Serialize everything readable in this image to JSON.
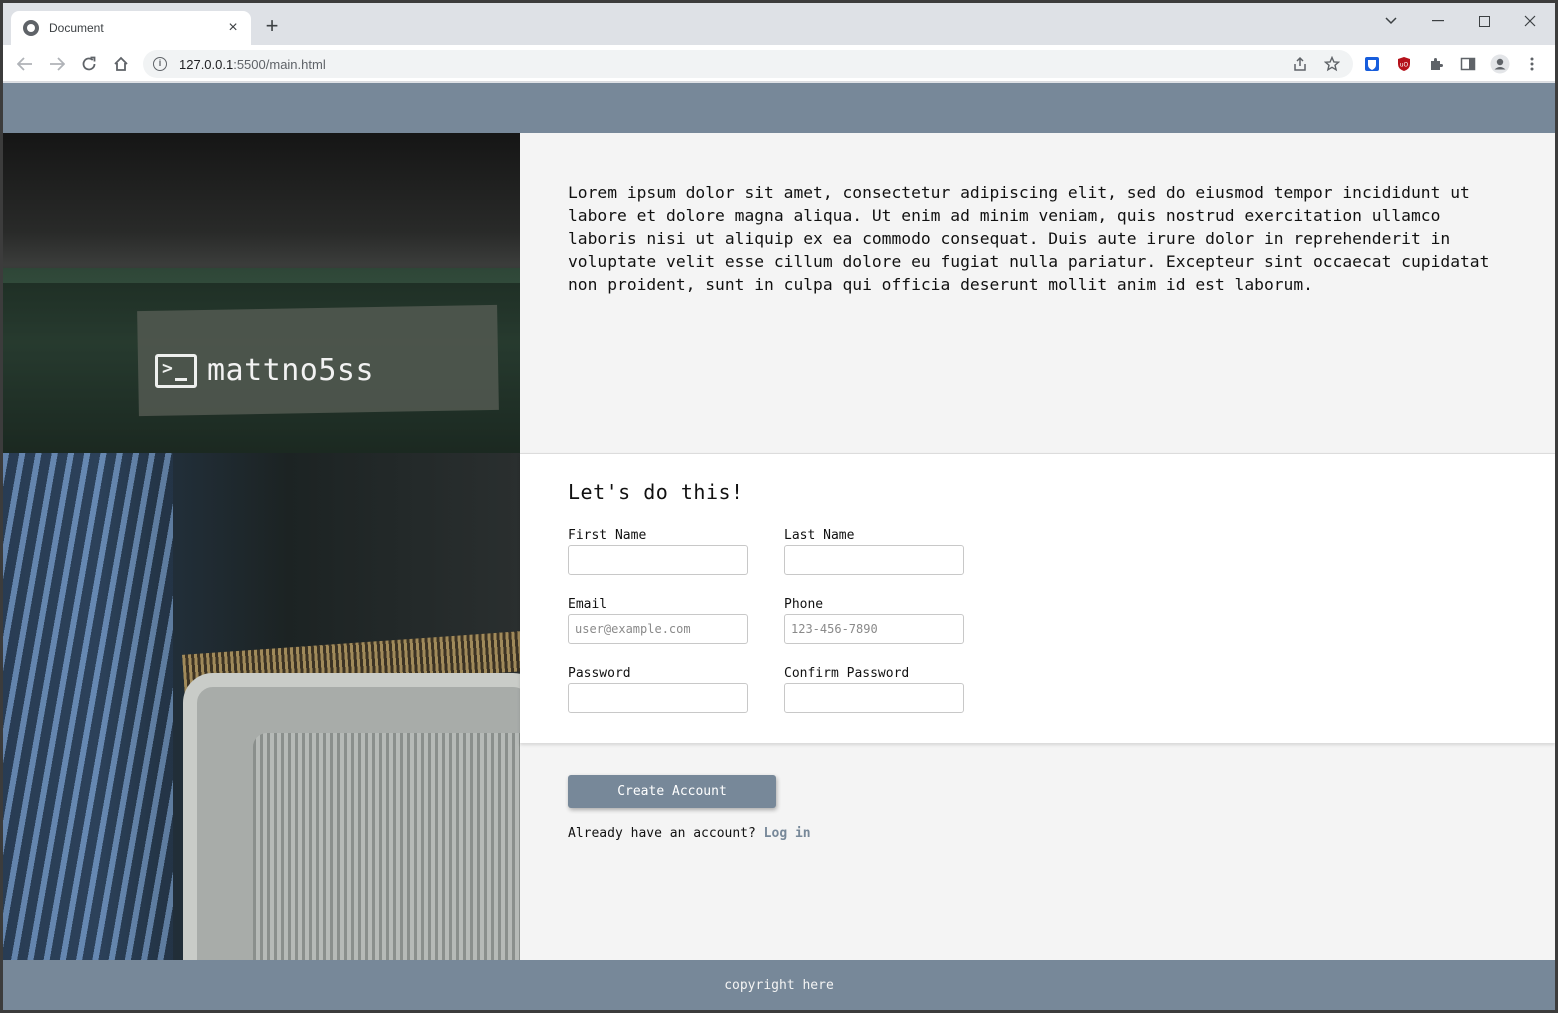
{
  "browser": {
    "tab_title": "Document",
    "tab_close": "×",
    "new_tab": "+",
    "url_host": "127.0.0.1",
    "url_rest": ":5500/main.html"
  },
  "site": {
    "brand_name": "mattno5ss"
  },
  "intro": {
    "text": "Lorem ipsum dolor sit amet, consectetur adipiscing elit, sed do eiusmod tempor incididunt ut labore et dolore magna aliqua. Ut enim ad minim veniam, quis nostrud exercitation ullamco laboris nisi ut aliquip ex ea commodo consequat. Duis aute irure dolor in reprehenderit in voluptate velit esse cillum dolore eu fugiat nulla pariatur. Excepteur sint occaecat cupidatat non proident, sunt in culpa qui officia deserunt mollit anim id est laborum."
  },
  "form": {
    "heading": "Let's do this!",
    "first_name_label": "First Name",
    "last_name_label": "Last Name",
    "email_label": "Email",
    "email_placeholder": "user@example.com",
    "phone_label": "Phone",
    "phone_placeholder": "123-456-7890",
    "password_label": "Password",
    "confirm_password_label": "Confirm Password"
  },
  "actions": {
    "create_account": "Create Account",
    "login_prompt": "Already have an account?",
    "login_link": "Log in"
  },
  "footer": {
    "text": "copyright here"
  },
  "colors": {
    "accent": "#778899"
  }
}
